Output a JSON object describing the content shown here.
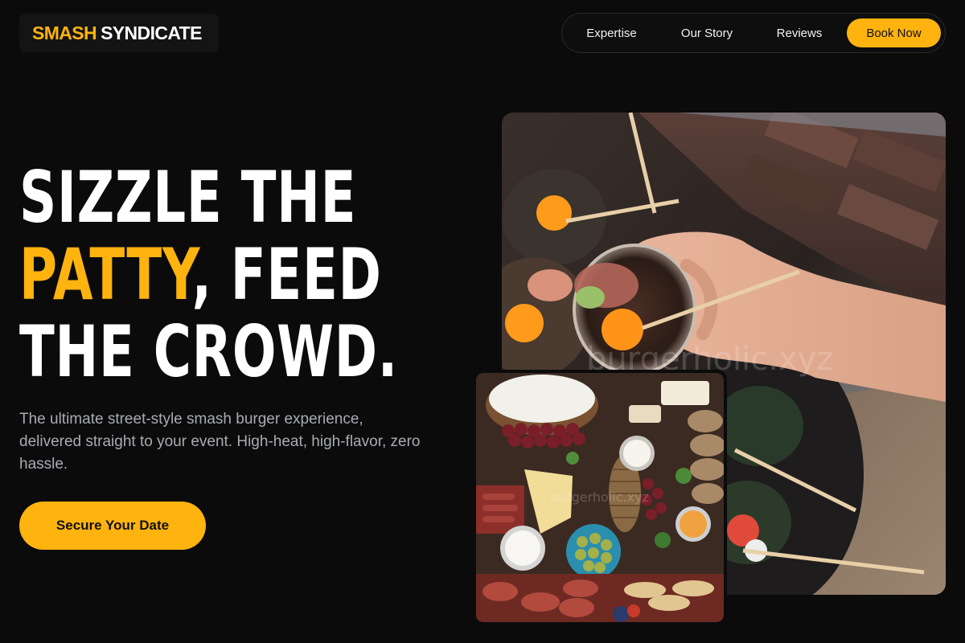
{
  "brand": {
    "name_accent": "SMASH",
    "name_main": "SYNDICATE",
    "accent_color": "#ffb30f"
  },
  "nav": {
    "items": [
      {
        "label": "Expertise"
      },
      {
        "label": "Our Story"
      },
      {
        "label": "Reviews"
      }
    ],
    "cta_label": "Book Now"
  },
  "hero": {
    "headline": {
      "line1": "SIZZLE THE",
      "line2_accent": "PATTY",
      "line2_rest": ", FEED",
      "line3": "THE CROWD."
    },
    "subtext": "The ultimate street-style smash burger experience, delivered straight to your event. High-heat, high-flavor, zero hassle.",
    "cta_label": "Secure Your Date"
  },
  "images": {
    "main": {
      "watermark": "burgerholic.xyz",
      "icon": "photo-hand-holding-appetizer-glass"
    },
    "secondary": {
      "watermark": "burgerholic.xyz",
      "icon": "photo-charcuterie-board"
    }
  },
  "colors": {
    "background": "#0b0b0c",
    "accent": "#ffb30f",
    "text": "#ffffff",
    "muted_text": "#a9abb3"
  }
}
